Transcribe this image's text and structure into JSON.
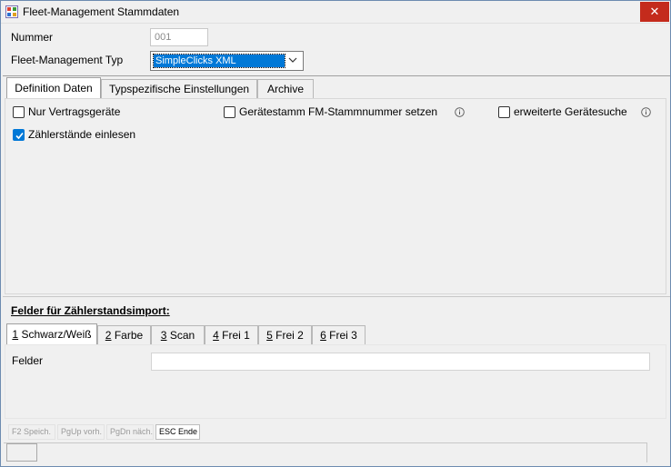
{
  "window": {
    "title": "Fleet-Management Stammdaten",
    "close_label": "✕"
  },
  "form": {
    "nummer_label": "Nummer",
    "nummer_value": "001",
    "typ_label": "Fleet-Management Typ",
    "typ_value": "SimpleClicks XML"
  },
  "top_tabs": [
    {
      "label": "Definition Daten",
      "active": true
    },
    {
      "label": "Typspezifische Einstellungen",
      "active": false
    },
    {
      "label": "Archive",
      "active": false
    }
  ],
  "options": [
    {
      "label": "Nur Vertragsgeräte",
      "checked": false
    },
    {
      "label": "Gerätestamm FM-Stammnummer setzen",
      "checked": false,
      "info": true
    },
    {
      "label": "erweiterte Gerätesuche",
      "checked": false,
      "info": true
    },
    {
      "label": "Zählerstände einlesen",
      "checked": true
    }
  ],
  "section_title": "Felder für Zählerstandsimport:",
  "counter_tabs": [
    {
      "key": "1",
      "label": "Schwarz/Weiß",
      "active": true
    },
    {
      "key": "2",
      "label": "Farbe",
      "active": false
    },
    {
      "key": "3",
      "label": "Scan",
      "active": false
    },
    {
      "key": "4",
      "label": "Frei 1",
      "active": false
    },
    {
      "key": "5",
      "label": "Frei 2",
      "active": false
    },
    {
      "key": "6",
      "label": "Frei 3",
      "active": false
    }
  ],
  "felder": {
    "label": "Felder",
    "value": ""
  },
  "function_keys": [
    {
      "label": "F2 Speich.",
      "enabled": false
    },
    {
      "label": "PgUp vorh.",
      "enabled": false
    },
    {
      "label": "PgDn näch.",
      "enabled": false
    },
    {
      "label": "ESC Ende",
      "enabled": true
    }
  ],
  "colors": {
    "accent": "#0078d7",
    "close": "#c42b1c"
  }
}
